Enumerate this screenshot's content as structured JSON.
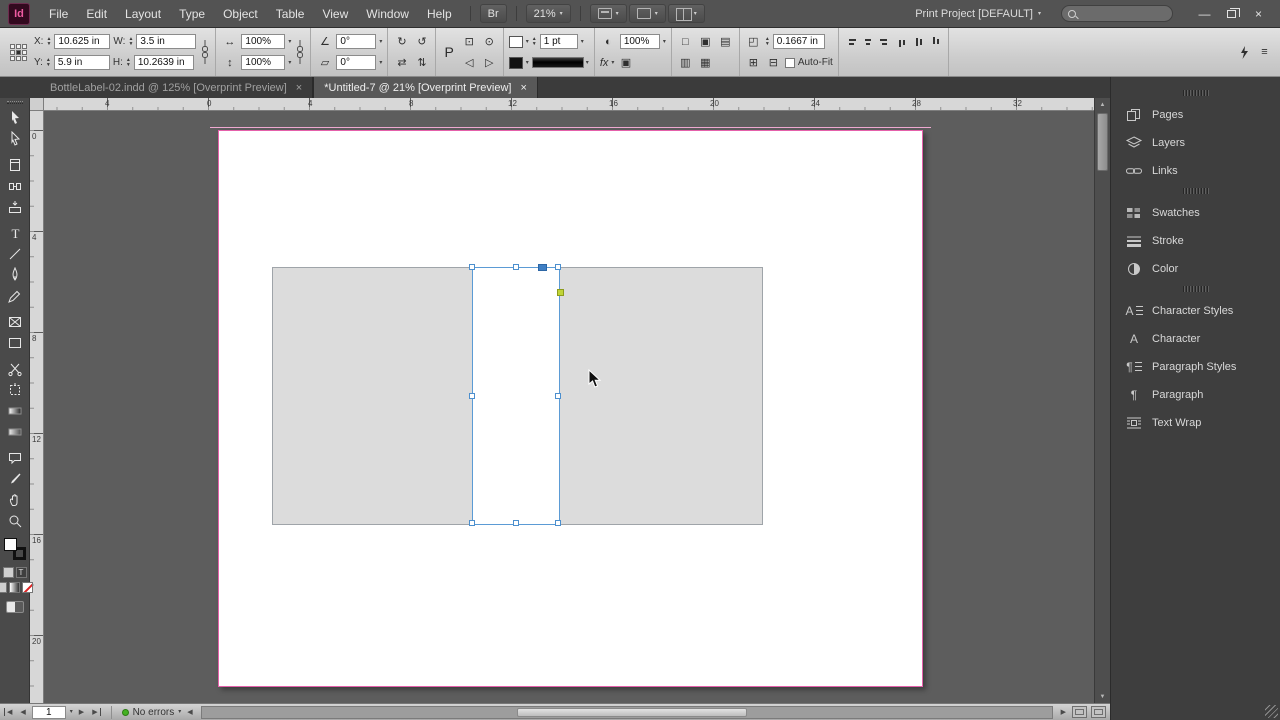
{
  "app_bar": {
    "logo_text": "Id",
    "menus": [
      "File",
      "Edit",
      "Layout",
      "Type",
      "Object",
      "Table",
      "View",
      "Window",
      "Help"
    ],
    "bridge_label": "Br",
    "zoom_value": "21%",
    "workspace_label": "Print Project [DEFAULT]"
  },
  "control_panel": {
    "x_label": "X:",
    "x_value": "10.625 in",
    "y_label": "Y:",
    "y_value": "5.9 in",
    "w_label": "W:",
    "w_value": "3.5 in",
    "h_label": "H:",
    "h_value": "10.2639 in",
    "scale_x_value": "100%",
    "scale_y_value": "100%",
    "rotation_value": "0°",
    "shear_value": "0°",
    "p_label": "P",
    "stroke_weight_value": "1 pt",
    "opacity_value": "100%",
    "fx_label": "fx",
    "gap_value": "0.1667 in",
    "autofit_label": "Auto-Fit"
  },
  "document_tabs": [
    {
      "title": "BottleLabel-02.indd @ 125% [Overprint Preview]"
    },
    {
      "title": "*Untitled-7 @ 21% [Overprint Preview]"
    }
  ],
  "rulers": {
    "horizontal": [
      "4",
      "0",
      "4",
      "8",
      "12",
      "16",
      "20",
      "24",
      "28",
      "32"
    ],
    "vertical": [
      "0",
      "4",
      "8",
      "12",
      "16",
      "20"
    ]
  },
  "panel_dock": [
    "Pages",
    "Layers",
    "Links",
    "Swatches",
    "Stroke",
    "Color",
    "Character Styles",
    "Character",
    "Paragraph Styles",
    "Paragraph",
    "Text Wrap"
  ],
  "status_bar": {
    "page_number": "1",
    "preflight_status": "No errors"
  },
  "colors": {
    "selection_blue": "#5b9bd5",
    "margin_magenta": "#e561ab",
    "corner_widget_yellow": "#c0d437",
    "preflight_green": "#44b122",
    "label_frame_fill": "#dcdcdc"
  },
  "glyphs": {
    "dropdown": "▾",
    "close": "×",
    "up": "▲",
    "down": "▼",
    "left": "◀",
    "right": "▶",
    "menu": "≡",
    "minimize": "—"
  }
}
